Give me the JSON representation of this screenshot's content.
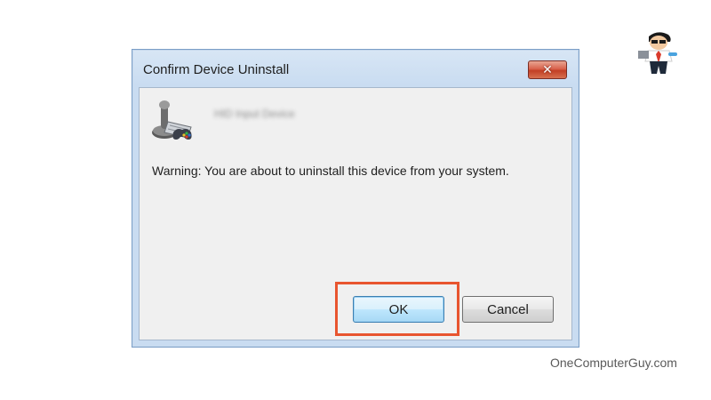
{
  "dialog": {
    "title": "Confirm Device Uninstall",
    "close_label": "✕",
    "device_name_blurred": "HID Input Device",
    "warning_text": "Warning: You are about to uninstall this device from your system.",
    "ok_label": "OK",
    "cancel_label": "Cancel"
  },
  "annotation": {
    "highlight_color": "#e8552f",
    "highlighted_control": "ok-button"
  },
  "branding": {
    "watermark": "OneComputerGuy.com"
  },
  "icons": {
    "device": "game-controller-device-icon",
    "close": "close-icon",
    "mascot": "mascot-logo"
  }
}
